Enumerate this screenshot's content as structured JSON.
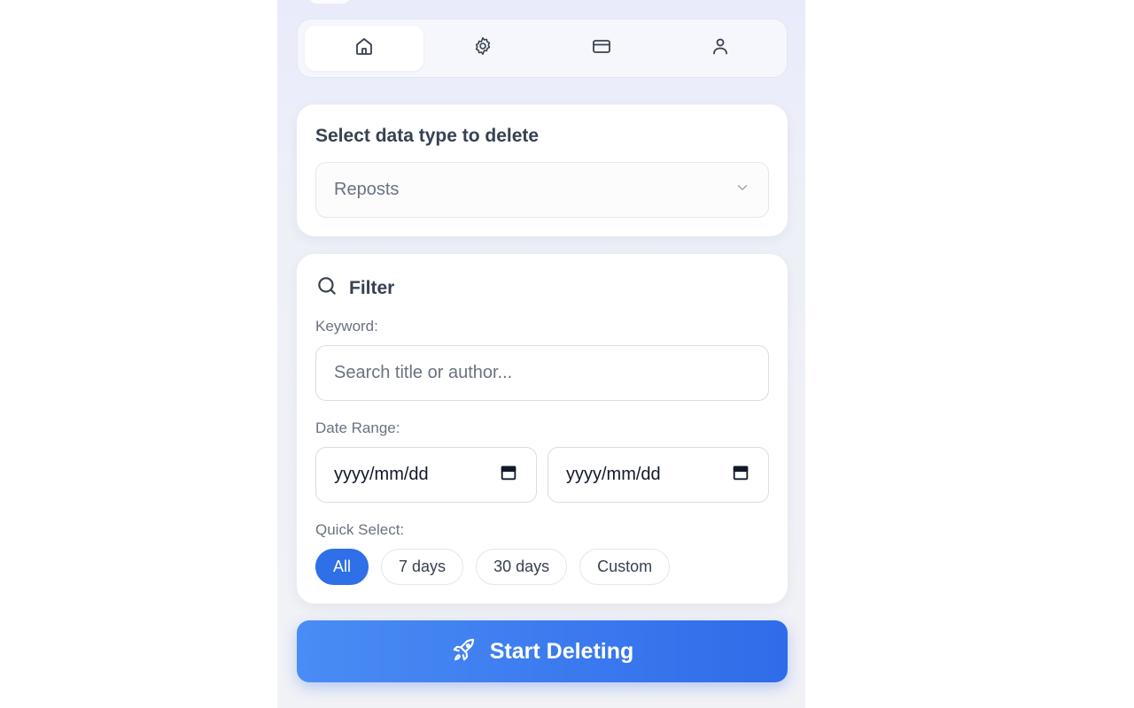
{
  "nav": {
    "tabs": [
      {
        "icon": "home-icon",
        "active": true
      },
      {
        "icon": "gear-icon",
        "active": false
      },
      {
        "icon": "credit-card-icon",
        "active": false
      },
      {
        "icon": "user-icon",
        "active": false
      }
    ]
  },
  "data_type": {
    "title": "Select data type to delete",
    "selected": "Reposts"
  },
  "filter": {
    "title": "Filter",
    "keyword_label": "Keyword:",
    "keyword_placeholder": "Search title or author...",
    "keyword_value": "",
    "date_range_label": "Date Range:",
    "date_start_placeholder": "yyyy/mm/dd",
    "date_end_placeholder": "yyyy/mm/dd",
    "quick_select_label": "Quick Select:",
    "quick_options": [
      "All",
      "7 days",
      "30 days",
      "Custom"
    ],
    "quick_selected": "All"
  },
  "actions": {
    "start_label": "Start Deleting"
  },
  "colors": {
    "accent": "#2f6fe8",
    "button_gradient_start": "#4a8cf5",
    "button_gradient_end": "#2f6ce9"
  }
}
